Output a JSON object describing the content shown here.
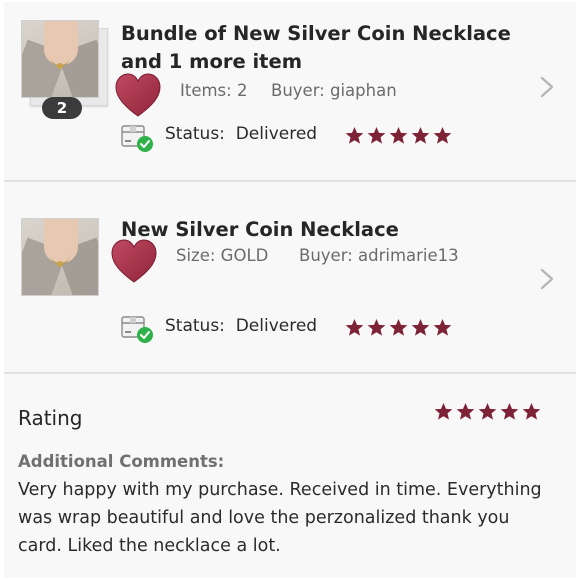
{
  "orders": [
    {
      "title": "Bundle of New Silver Coin Necklace and 1 more item",
      "bundle_count": "2",
      "meta_left": "Items: 2",
      "meta_right": "Buyer: giaphan",
      "status_label": "Status:",
      "status_value": "Delivered",
      "star_rating": 5
    },
    {
      "title": "New Silver Coin Necklace",
      "meta_left": "Size: GOLD",
      "meta_right": "Buyer: adrimarie13",
      "status_label": "Status:",
      "status_value": "Delivered",
      "star_rating": 5
    }
  ],
  "rating": {
    "title": "Rating",
    "stars": 5,
    "comments_label": "Additional Comments:",
    "comments_text": "Very happy with my purchase. Received in time. Everything was wrap beautiful and love the perzonalized thank you card. Liked the necklace a lot."
  },
  "colors": {
    "star": "#7e2337",
    "heart": "#a8304a",
    "check": "#2fb14a",
    "badge": "#3b3b3b",
    "chevron": "#b5b5b5"
  },
  "icons": {
    "heart": "heart-icon",
    "package": "package-check-icon",
    "chevron": "chevron-right-icon",
    "star": "star-icon"
  }
}
